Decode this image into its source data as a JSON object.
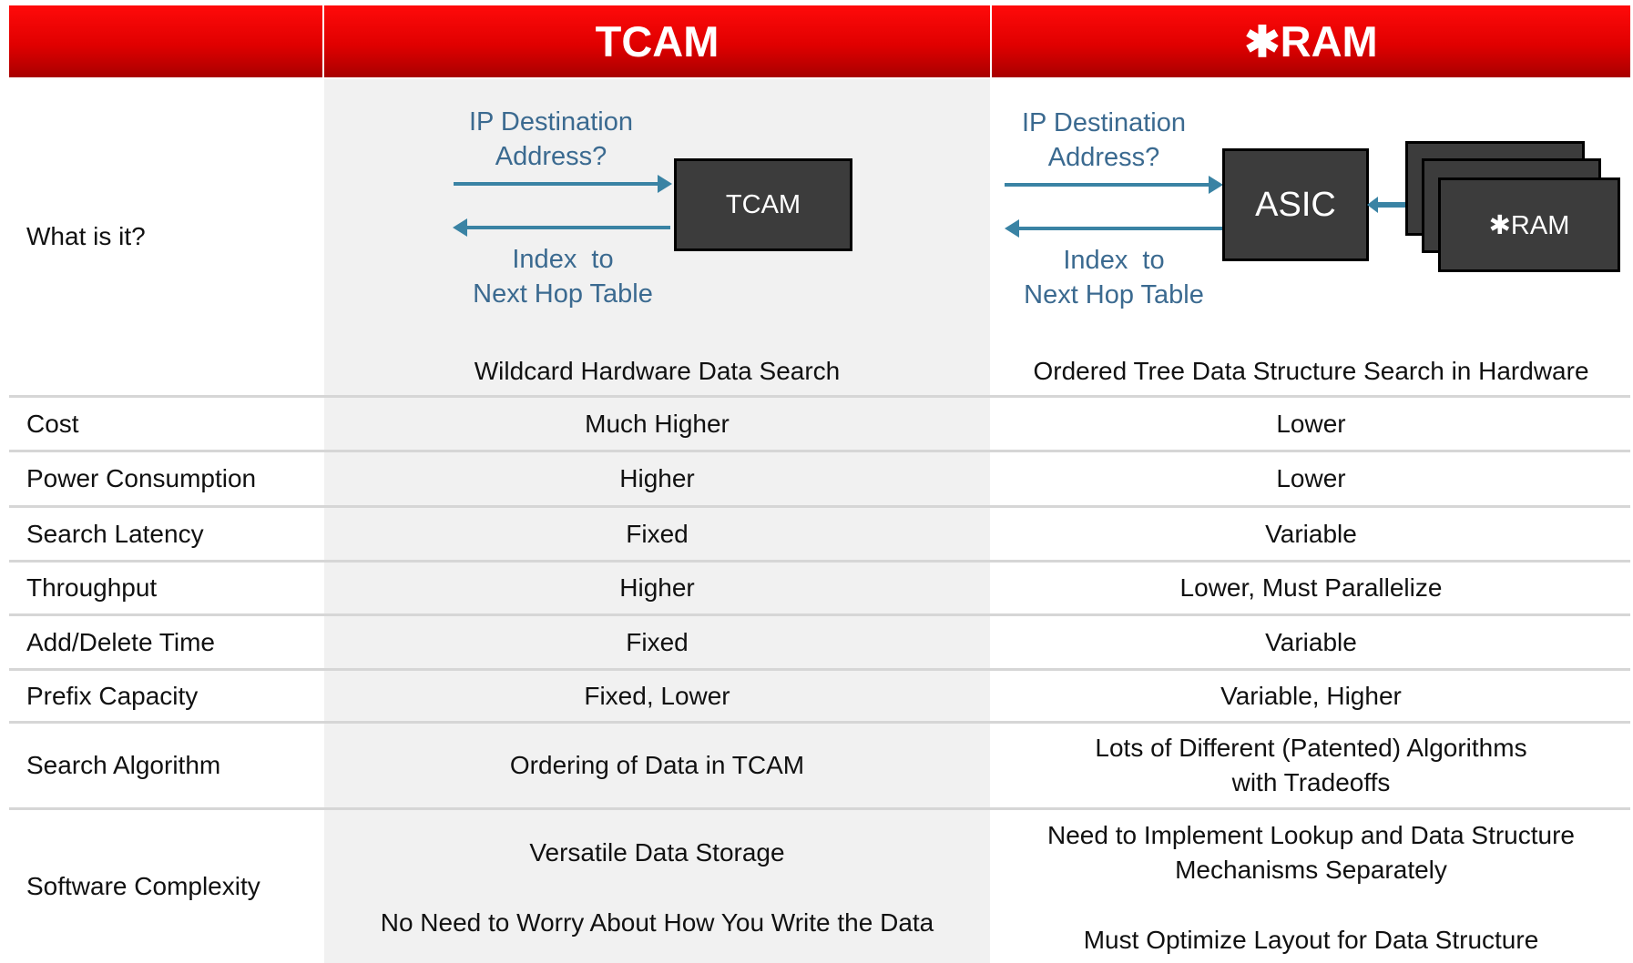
{
  "headers": {
    "tcam": "TCAM",
    "ram": "✱RAM"
  },
  "diagram_tcam": {
    "query_label": [
      "IP Destination",
      "Address?"
    ],
    "result_label": [
      "Index  to",
      "Next Hop Table"
    ],
    "box_label": "TCAM"
  },
  "diagram_ram": {
    "query_label": [
      "IP Destination",
      "Address?"
    ],
    "result_label": [
      "Index  to",
      "Next Hop Table"
    ],
    "asic_label": "ASIC",
    "ram_label": "✱RAM"
  },
  "rows": [
    {
      "label": "What is it?",
      "tcam": [
        "Wildcard Hardware Data Search"
      ],
      "ram": [
        "Ordered Tree Data Structure Search in Hardware"
      ]
    },
    {
      "label": "Cost",
      "tcam": [
        "Much Higher"
      ],
      "ram": [
        "Lower"
      ]
    },
    {
      "label": "Power Consumption",
      "tcam": [
        "Higher"
      ],
      "ram": [
        "Lower"
      ]
    },
    {
      "label": "Search Latency",
      "tcam": [
        "Fixed"
      ],
      "ram": [
        "Variable"
      ]
    },
    {
      "label": "Throughput",
      "tcam": [
        "Higher"
      ],
      "ram": [
        "Lower, Must Parallelize"
      ]
    },
    {
      "label": "Add/Delete Time",
      "tcam": [
        "Fixed"
      ],
      "ram": [
        "Variable"
      ]
    },
    {
      "label": "Prefix Capacity",
      "tcam": [
        "Fixed, Lower"
      ],
      "ram": [
        "Variable, Higher"
      ]
    },
    {
      "label": "Search Algorithm",
      "tcam": [
        "Ordering of Data in TCAM"
      ],
      "ram": [
        "Lots of Different (Patented) Algorithms",
        "with Tradeoffs"
      ]
    },
    {
      "label": "Software Complexity",
      "tcam": [
        "Versatile Data Storage",
        "No Need to Worry About How You Write the Data"
      ],
      "ram": [
        "Need to Implement Lookup and Data Structure",
        "Mechanisms Separately",
        "Must Optimize Layout for Data Structure"
      ]
    }
  ]
}
